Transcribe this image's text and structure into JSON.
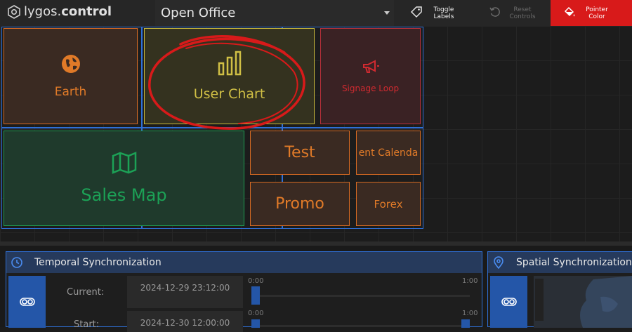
{
  "app": {
    "logo_prefix": "lygos.",
    "logo_suffix": "control"
  },
  "topbar": {
    "room": "Open Office",
    "toggle_labels": "Toggle Labels",
    "reset_controls": "Reset Controls",
    "pointer_color": "Pointer Color"
  },
  "tiles": {
    "earth": "Earth",
    "user_chart": "User Chart",
    "signage": "Signage Loop",
    "sales_map": "Sales Map",
    "test": "Test",
    "calendar": "ent Calenda",
    "promo": "Promo",
    "forex": "Forex"
  },
  "colors": {
    "screen_border": "#2f6fd6",
    "earth": "#e07a28",
    "user_chart": "#d0bf45",
    "signage": "#d02a30",
    "sales_map": "#1ca156",
    "annotation": "#d81a1a",
    "pointer_color_button": "#d81a1a"
  },
  "temporal": {
    "title": "Temporal Synchronization",
    "current_label": "Current:",
    "current_value": "2024-12-29 23:12:00",
    "start_label": "Start:",
    "start_value": "2024-12-30 12:00:00",
    "slider1_min": "0:00",
    "slider1_max": "1:00",
    "slider2_min": "0:00",
    "slider2_max": "1:00"
  },
  "spatial": {
    "title": "Spatial Synchronization"
  }
}
